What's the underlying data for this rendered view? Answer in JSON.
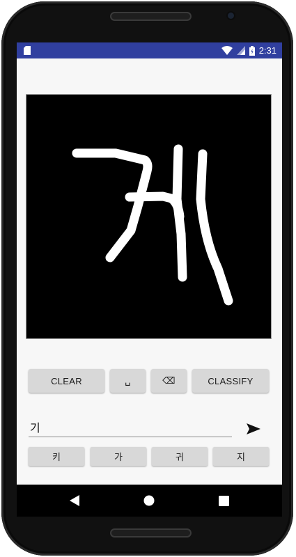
{
  "status_bar": {
    "time": "2:31",
    "icons": [
      "sd-card-icon",
      "wifi-icon",
      "signal-icon",
      "battery-icon"
    ]
  },
  "drawing_canvas": {
    "background": "#000000",
    "stroke_color": "#ffffff"
  },
  "controls": {
    "clear_label": "CLEAR",
    "space_label": "␣",
    "backspace_label": "⌫",
    "classify_label": "CLASSIFY"
  },
  "input": {
    "value": "기"
  },
  "suggestions": [
    "키",
    "가",
    "귀",
    "지"
  ],
  "colors": {
    "status_bar": "#303f9f",
    "button_bg": "#d8d8d8",
    "screen_bg": "#f7f7f7"
  }
}
